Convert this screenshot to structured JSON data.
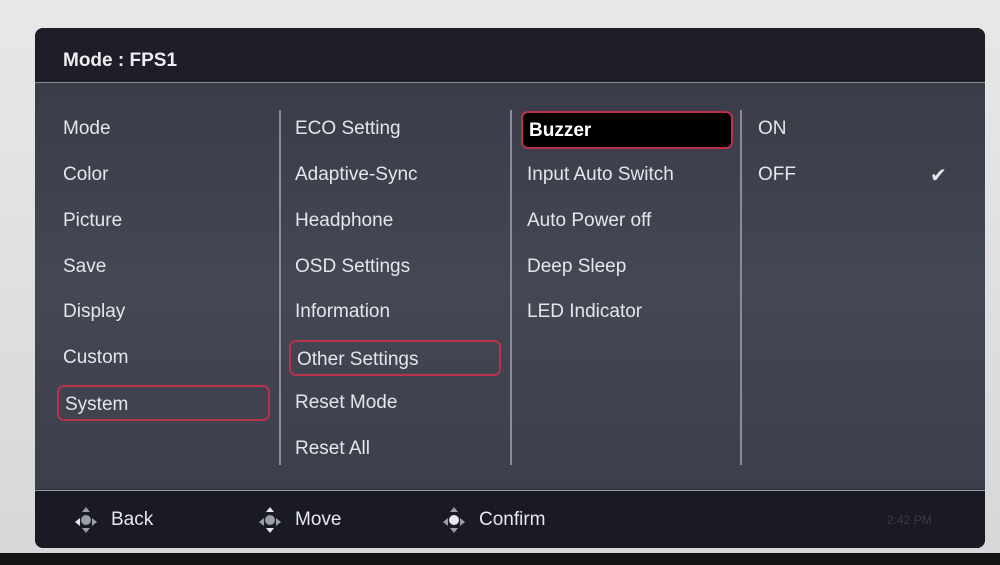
{
  "header": {
    "title": "Mode : FPS1"
  },
  "menu": {
    "main": [
      "Mode",
      "Color",
      "Picture",
      "Save",
      "Display",
      "Custom",
      "System"
    ],
    "main_selected": 6,
    "system": [
      "ECO Setting",
      "Adaptive-Sync",
      "Headphone",
      "OSD Settings",
      "Information",
      "Other Settings",
      "Reset Mode",
      "Reset All"
    ],
    "system_selected": 5,
    "other_settings": [
      "Buzzer",
      "Input Auto Switch",
      "Auto Power off",
      "Deep Sleep",
      "LED Indicator"
    ],
    "other_selected": 0,
    "options": [
      "ON",
      "OFF"
    ],
    "options_checked": 1,
    "check_icon": "check-icon"
  },
  "footer": {
    "back": "Back",
    "move": "Move",
    "confirm": "Confirm"
  },
  "taskbar": {
    "time": "2:42 PM"
  },
  "colors": {
    "highlight_border": "#b8324a",
    "background": "#3a3c48",
    "header": "#1d1e27"
  }
}
